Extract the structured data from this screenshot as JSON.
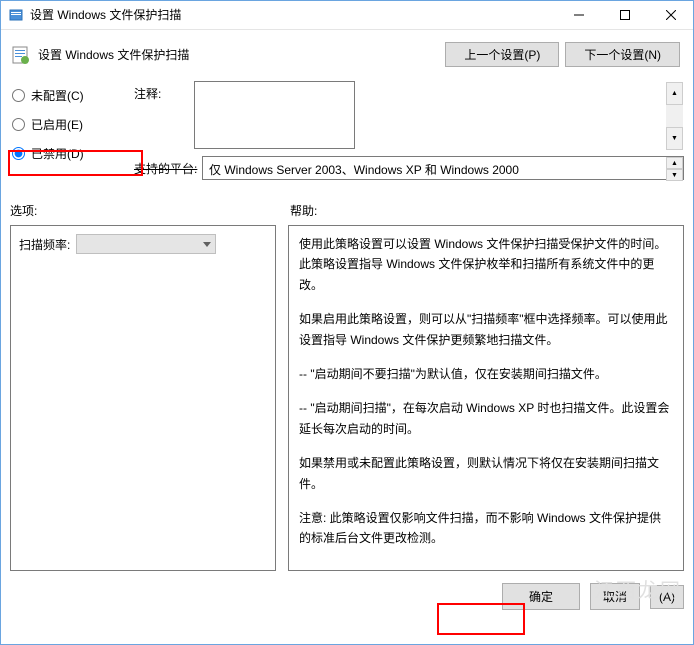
{
  "window": {
    "title": "设置 Windows 文件保护扫描"
  },
  "header": {
    "title": "设置 Windows 文件保护扫描",
    "prev_setting": "上一个设置(P)",
    "next_setting": "下一个设置(N)"
  },
  "radios": {
    "not_configured": "未配置(C)",
    "enabled": "已启用(E)",
    "disabled": "已禁用(D)"
  },
  "fields": {
    "comment_label": "注释:",
    "comment_value": "",
    "platform_label": "支持的平台:",
    "platform_value": "仅 Windows Server 2003、Windows XP 和 Windows 2000"
  },
  "section_labels": {
    "options": "选项:",
    "help": "帮助:"
  },
  "options": {
    "scan_freq_label": "扫描频率:",
    "scan_freq_value": ""
  },
  "help": {
    "p1": "使用此策略设置可以设置 Windows 文件保护扫描受保护文件的时间。此策略设置指导 Windows 文件保护枚举和扫描所有系统文件中的更改。",
    "p2": "如果启用此策略设置，则可以从\"扫描频率\"框中选择频率。可以使用此设置指导 Windows 文件保护更频繁地扫描文件。",
    "p3": "-- \"启动期间不要扫描\"为默认值，仅在安装期间扫描文件。",
    "p4": "-- \"启动期间扫描\"，在每次启动 Windows XP 时也扫描文件。此设置会延长每次启动的时间。",
    "p5": "如果禁用或未配置此策略设置，则默认情况下将仅在安装期间扫描文件。",
    "p6": "注意: 此策略设置仅影响文件扫描，而不影响 Windows 文件保护提供的标准后台文件更改检测。"
  },
  "footer": {
    "ok": "确定",
    "cancel": "取消",
    "apply": "(A)"
  },
  "watermark": "江西龙网"
}
